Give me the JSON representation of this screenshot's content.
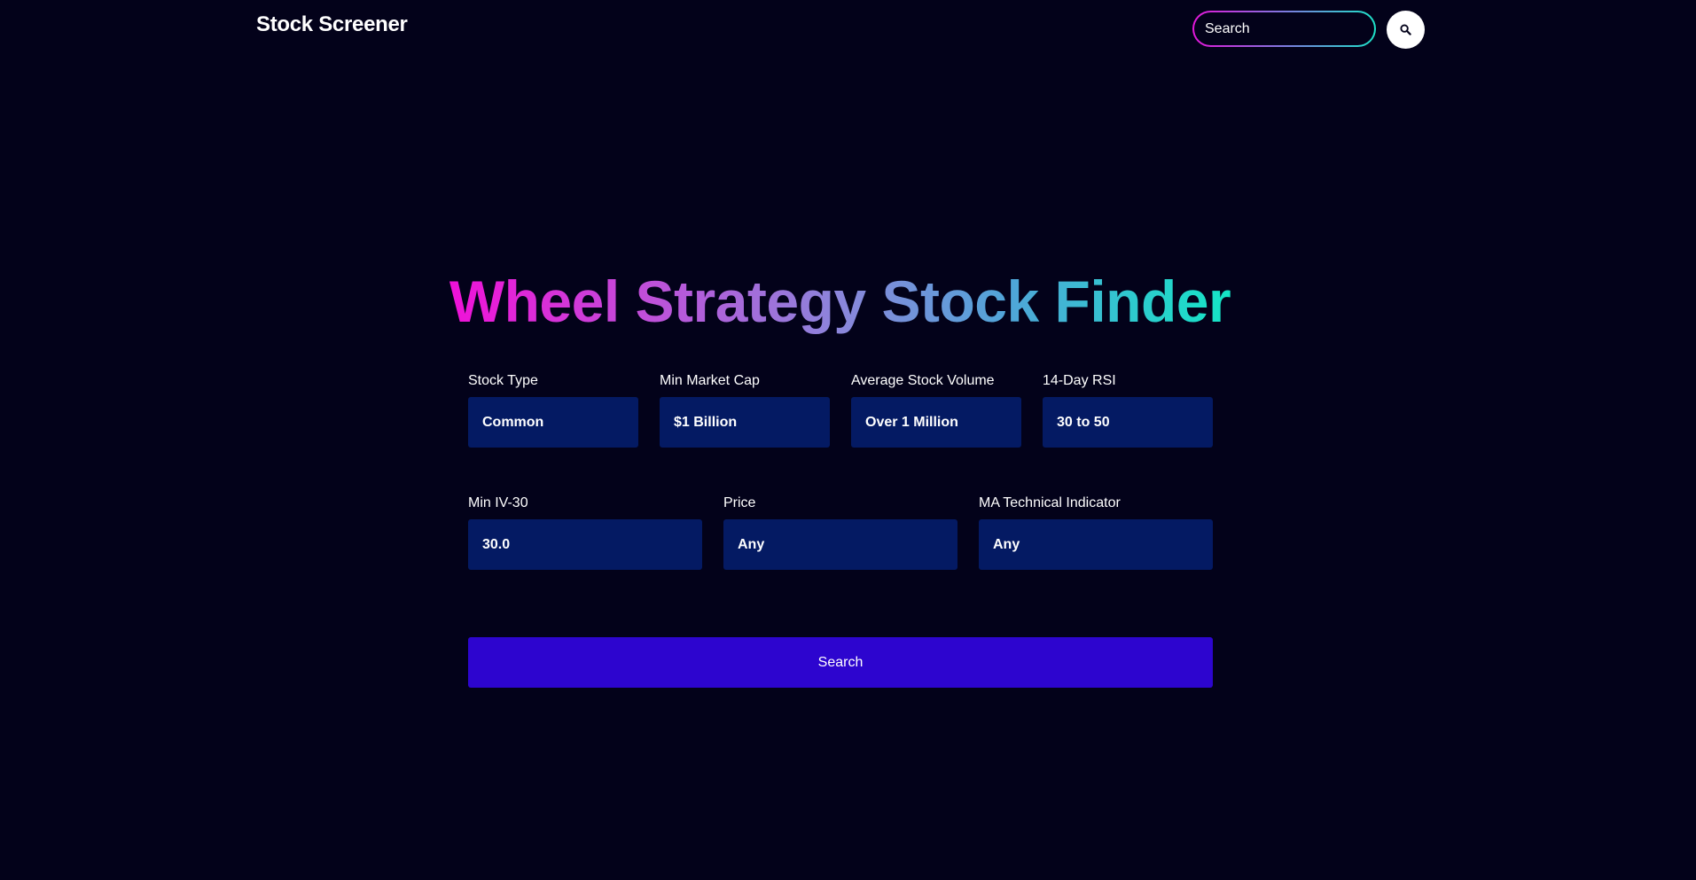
{
  "header": {
    "brand": "Stock Screener",
    "search_placeholder": "Search",
    "search_button_icon": "search-icon"
  },
  "main": {
    "title": "Wheel Strategy Stock Finder",
    "title_gradient": [
      "#f011d8",
      "#8b86db",
      "#14e6c6"
    ],
    "filters_row1": [
      {
        "label": "Stock Type",
        "value": "Common"
      },
      {
        "label": "Min Market Cap",
        "value": "$1 Billion"
      },
      {
        "label": "Average Stock Volume",
        "value": "Over 1 Million"
      },
      {
        "label": "14-Day RSI",
        "value": "30 to 50"
      }
    ],
    "filters_row2": [
      {
        "label": "Min IV-30",
        "value": "30.0"
      },
      {
        "label": "Price",
        "value": "Any"
      },
      {
        "label": "MA Technical Indicator",
        "value": "Any"
      }
    ],
    "submit_label": "Search"
  },
  "colors": {
    "background": "#03021a",
    "select_bg": "#041a63",
    "submit_bg": "#2d05cf"
  }
}
